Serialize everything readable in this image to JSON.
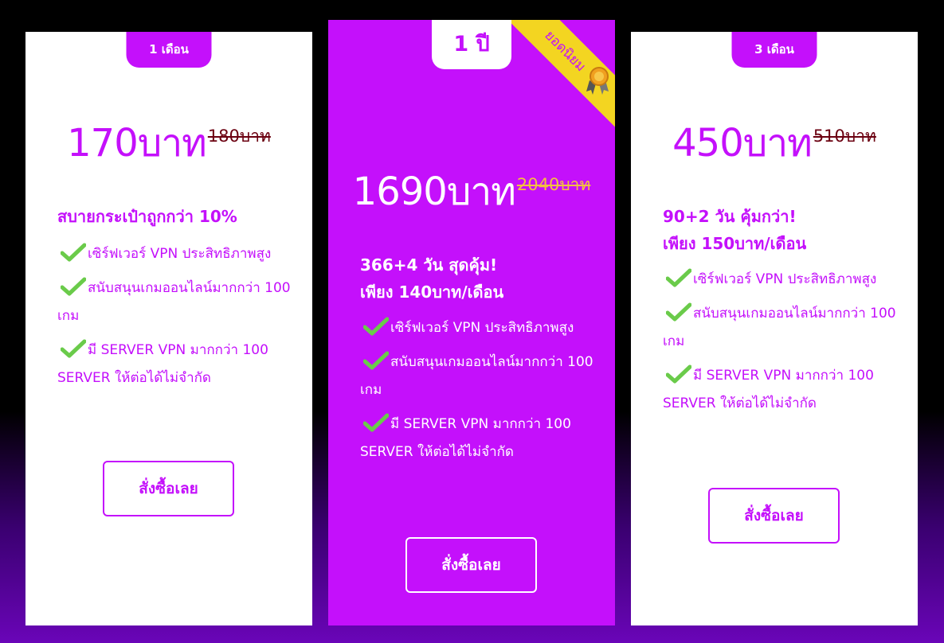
{
  "colors": {
    "accent": "#c410fb",
    "ribbon": "#f3d521",
    "check": "#6acb4a",
    "old_price_white": "#6b0010",
    "old_price_purple": "#f3c040"
  },
  "icons": {
    "feature": "check-icon",
    "badge": "medal-icon"
  },
  "plans": [
    {
      "tab": "1 เดือน",
      "price": "170บาท",
      "old_price": "180บาท",
      "headline": [
        "สบายกระเป๋าถูกกว่า 10%"
      ],
      "features": [
        "เซิร์ฟเวอร์ VPN ประสิทธิภาพสูง",
        "สนับสนุนเกมออนไลน์มากกว่า 100 เกม",
        "มี SERVER VPN มากกว่า 100 SERVER ให้ต่อได้ไม่จำกัด"
      ],
      "button": "สั่งซื้อเลย"
    },
    {
      "tab": "1 ปี",
      "ribbon": "ยอดนิยม",
      "price": "1690บาท",
      "old_price": "2040บาท",
      "headline": [
        "366+4 วัน สุดคุ้ม!",
        "เพียง 140บาท/เดือน"
      ],
      "features": [
        "เซิร์ฟเวอร์ VPN ประสิทธิภาพสูง",
        "สนับสนุนเกมออนไลน์มากกว่า 100 เกม",
        "มี SERVER VPN มากกว่า 100 SERVER ให้ต่อได้ไม่จำกัด"
      ],
      "button": "สั่งซื้อเลย"
    },
    {
      "tab": "3 เดือน",
      "price": "450บาท",
      "old_price": "510บาท",
      "headline": [
        "90+2 วัน คุ้มกว่า!",
        "เพียง 150บาท/เดือน"
      ],
      "features": [
        "เซิร์ฟเวอร์ VPN ประสิทธิภาพสูง",
        "สนับสนุนเกมออนไลน์มากกว่า 100 เกม",
        "มี SERVER VPN มากกว่า 100 SERVER ให้ต่อได้ไม่จำกัด"
      ],
      "button": "สั่งซื้อเลย"
    }
  ]
}
